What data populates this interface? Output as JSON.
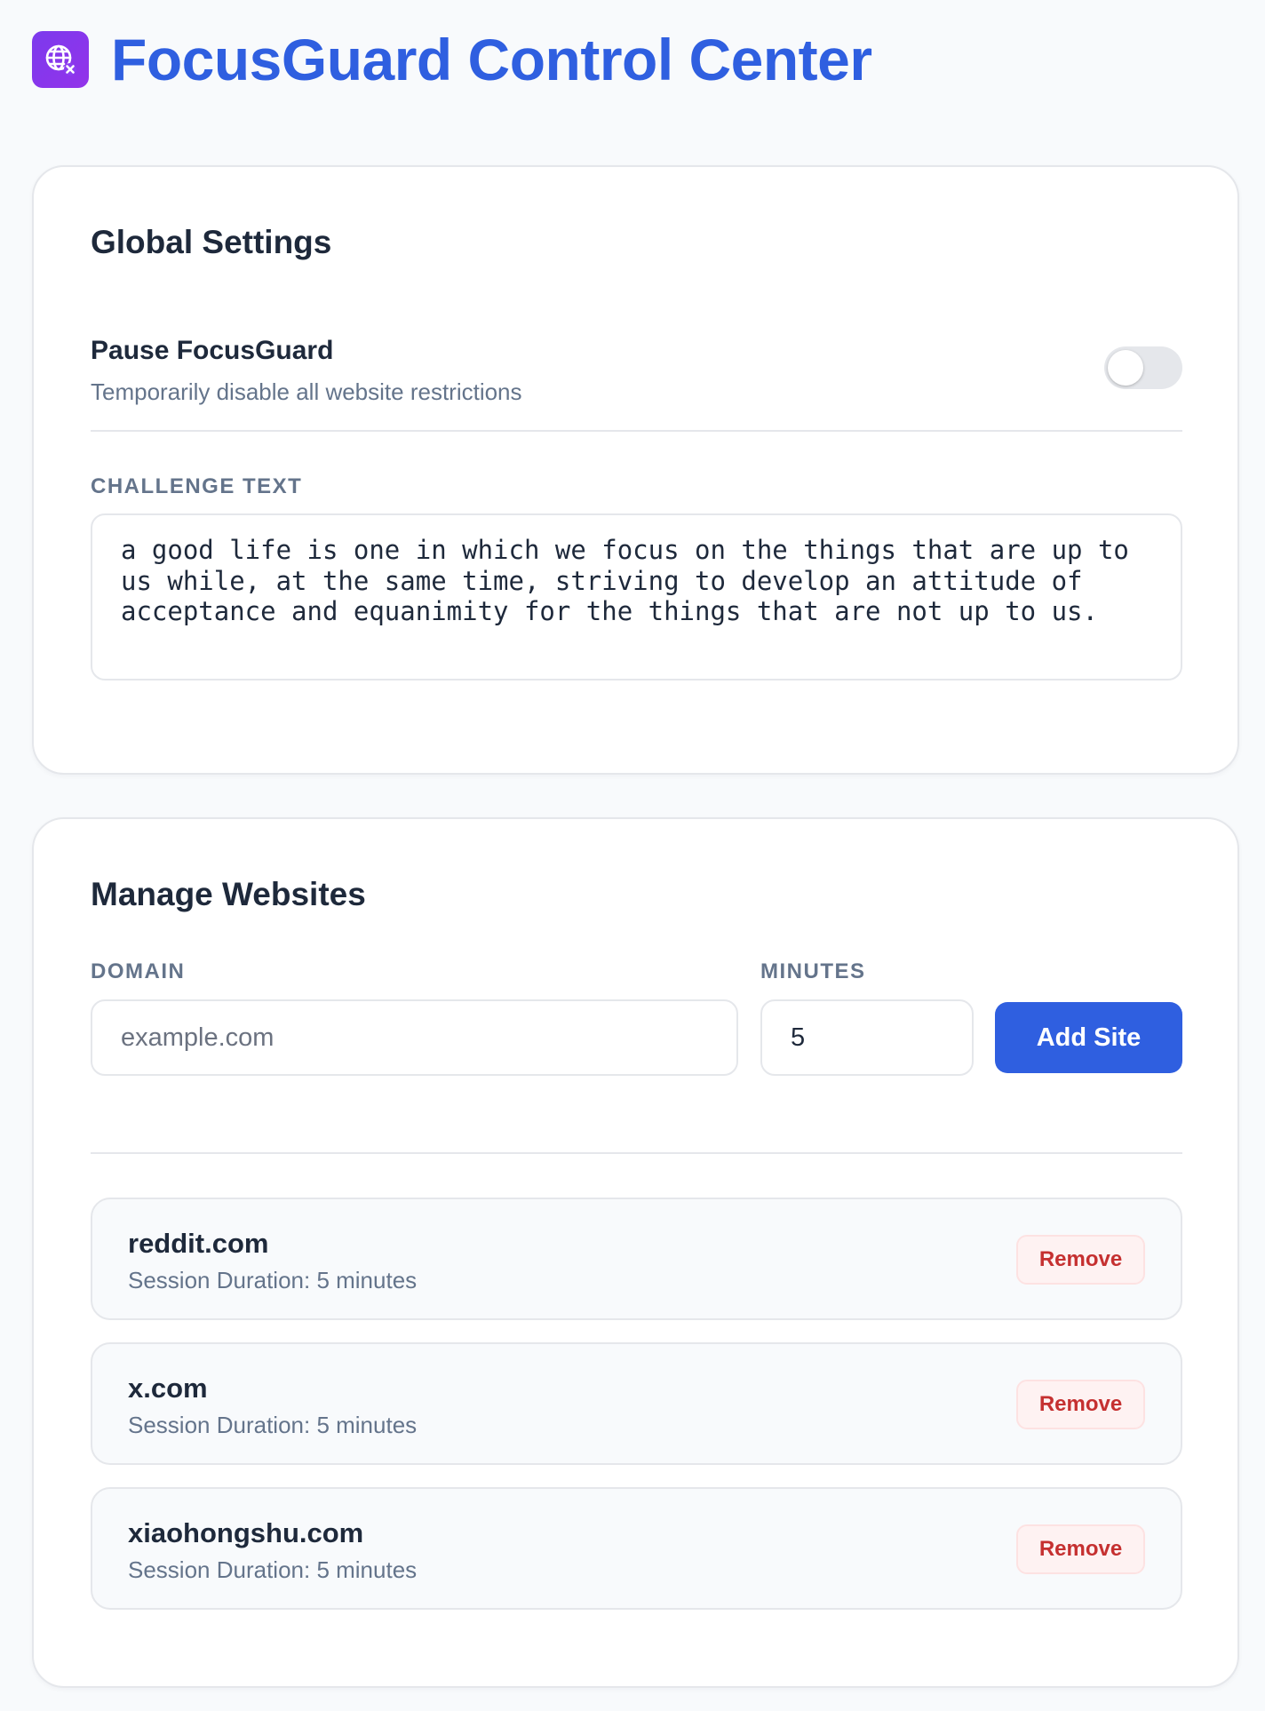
{
  "app": {
    "title": "FocusGuard Control Center",
    "logo_icon": "globe-block-icon"
  },
  "global_settings": {
    "title": "Global Settings",
    "pause": {
      "label": "Pause FocusGuard",
      "description": "Temporarily disable all website restrictions",
      "enabled": false
    },
    "challenge": {
      "label": "CHALLENGE TEXT",
      "text": "a good life is one in which we focus on the things that are up to us while, at the same time, striving to develop an attitude of acceptance and equanimity for the things that are not up to us."
    }
  },
  "manage_websites": {
    "title": "Manage Websites",
    "domain_label": "DOMAIN",
    "domain_placeholder": "example.com",
    "domain_value": "",
    "minutes_label": "MINUTES",
    "minutes_value": "5",
    "add_button": "Add Site",
    "sites": [
      {
        "domain": "reddit.com",
        "duration": "Session Duration: 5 minutes",
        "remove_label": "Remove"
      },
      {
        "domain": "x.com",
        "duration": "Session Duration: 5 minutes",
        "remove_label": "Remove"
      },
      {
        "domain": "xiaohongshu.com",
        "duration": "Session Duration: 5 minutes",
        "remove_label": "Remove"
      }
    ]
  },
  "colors": {
    "accent": "#2f5fe0",
    "logo_bg": "#7c3aed",
    "danger": "#c53030",
    "muted": "#64748b"
  }
}
